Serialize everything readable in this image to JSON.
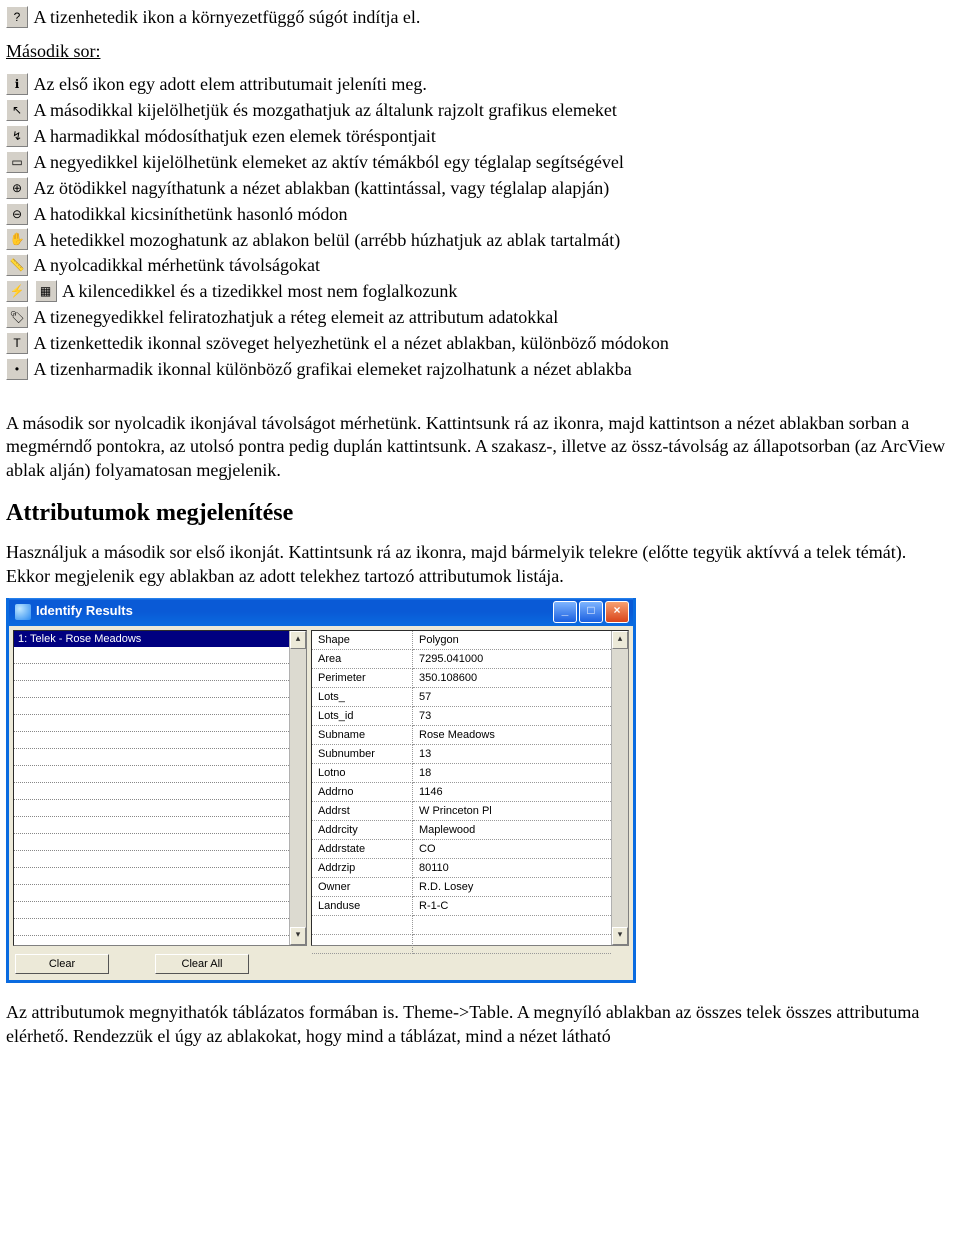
{
  "lines": {
    "l17": "A tizenhetedik ikon a környezetfüggő súgót indítja el.",
    "row2_label": "Második sor:",
    "r1": "Az első ikon egy adott elem attributumait jeleníti meg.",
    "r2": "A másodikkal kijelölhetjük és mozgathatjuk az általunk rajzolt grafikus elemeket",
    "r3": "A harmadikkal módosíthatjuk ezen elemek töréspontjait",
    "r4": "A negyedikkel kijelölhetünk elemeket az aktív témákból egy téglalap segítségével",
    "r5": "Az ötödikkel nagyíthatunk a nézet ablakban (kattintással, vagy téglalap alapján)",
    "r6": "A hatodikkal kicsiníthetünk hasonló módon",
    "r7": "A hetedikkel mozoghatunk az ablakon belül (arrébb húzhatjuk az ablak tartalmát)",
    "r8": "A nyolcadikkal mérhetünk távolságokat",
    "r9": "A  kilencedikkel és a tizedikkel most nem foglalkozunk",
    "r11": "A tizenegyedikkel feliratozhatjuk a réteg elemeit az attributum adatokkal",
    "r12": "A tizenkettedik ikonnal szöveget helyezhetünk el a nézet ablakban, különböző módokon",
    "r13": "A tizenharmadik ikonnal különböző grafikai elemeket rajzolhatunk a nézet ablakba"
  },
  "icons": {
    "help": "?",
    "info": "ℹ",
    "pointer": "↖",
    "edit": "↯",
    "rect": "▭",
    "zoomin": "⊕",
    "zoomout": "⊖",
    "pan": "✋",
    "measure": "📏",
    "spark": "⚡",
    "grid": "▦",
    "label": "🏷",
    "text": "T",
    "draw": "•"
  },
  "para_measure": "A második sor nyolcadik ikonjával távolságot mérhetünk. Kattintsunk rá az ikonra, majd kattintson a nézet ablakban sorban a megmérndő pontokra, az utolsó pontra pedig duplán kattintsunk. A szakasz-, illetve az össz-távolság az állapotsorban (az ArcView ablak alján) folyamatosan megjelenik.",
  "section_title": "Attributumok megjelenítése",
  "para_attr": "Használjuk a második sor első ikonját. Kattintsunk rá az ikonra, majd bármelyik telekre (előtte tegyük aktívvá a telek témát). Ekkor megjelenik egy ablakban az adott telekhez tartozó attributumok listája.",
  "dialog": {
    "title": "Identify Results",
    "selected_item": "1:   Telek - Rose Meadows",
    "buttons": {
      "clear": "Clear",
      "clear_all": "Clear All"
    },
    "attributes": [
      {
        "k": "Shape",
        "v": "Polygon"
      },
      {
        "k": "Area",
        "v": "7295.041000"
      },
      {
        "k": "Perimeter",
        "v": "350.108600"
      },
      {
        "k": "Lots_",
        "v": "57"
      },
      {
        "k": "Lots_id",
        "v": "73"
      },
      {
        "k": "Subname",
        "v": "Rose Meadows"
      },
      {
        "k": "Subnumber",
        "v": "13"
      },
      {
        "k": "Lotno",
        "v": "18"
      },
      {
        "k": "Addrno",
        "v": "1146"
      },
      {
        "k": "Addrst",
        "v": "W Princeton Pl"
      },
      {
        "k": "Addrcity",
        "v": "Maplewood"
      },
      {
        "k": "Addrstate",
        "v": "CO"
      },
      {
        "k": "Addrzip",
        "v": "80110"
      },
      {
        "k": "Owner",
        "v": "R.D. Losey"
      },
      {
        "k": "Landuse",
        "v": "R-1-C"
      }
    ]
  },
  "para_table": "Az attributumok megnyithatók táblázatos formában is. Theme->Table. A megnyíló ablakban az összes telek összes attributuma elérhető. Rendezzük el úgy az ablakokat, hogy mind a táblázat, mind a nézet látható"
}
